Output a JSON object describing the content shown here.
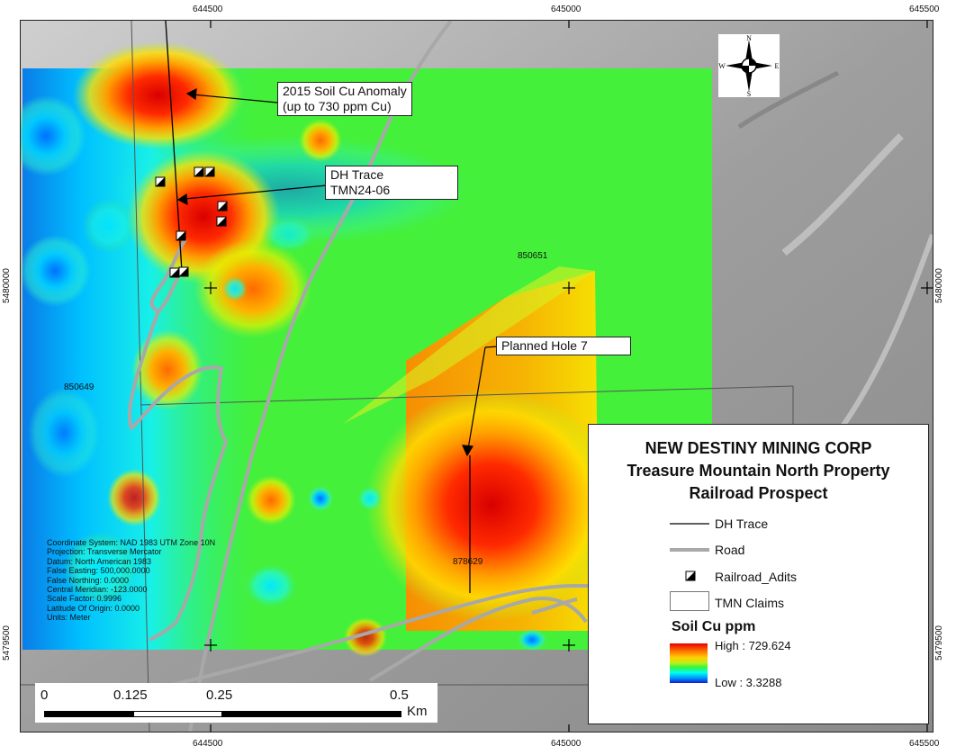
{
  "map": {
    "top_coords": [
      "644500",
      "645000",
      "645500"
    ],
    "bottom_coords": [
      "644500",
      "645000",
      "645500"
    ],
    "left_coords": [
      "5480000",
      "5479500"
    ],
    "right_coords": [
      "5480000",
      "5479500"
    ],
    "claim_labels": [
      "850651",
      "850649",
      "878629"
    ],
    "callouts": {
      "anomaly_line1": "2015 Soil Cu Anomaly",
      "anomaly_line2": "(up to 730 ppm Cu)",
      "dh_line1": "DH Trace",
      "dh_line2": "TMN24-06",
      "planned": "Planned Hole 7"
    },
    "north_arrow": {
      "n": "N",
      "s": "S",
      "e": "E",
      "w": "W",
      "icon": "north-arrow-icon"
    },
    "coordinate_info": [
      "Coordinate System: NAD 1983 UTM Zone 10N",
      "Projection: Transverse Mercator",
      "Datum: North American 1983",
      "False Easting: 500,000.0000",
      "False Northing: 0.0000",
      "Central Meridian: -123.0000",
      "Scale Factor: 0.9996",
      "Latitude Of Origin: 0.0000",
      "Units: Meter"
    ]
  },
  "legend": {
    "title1": "NEW DESTINY MINING CORP",
    "title2": "Treasure Mountain North Property",
    "title3": "Railroad Prospect",
    "items": [
      "DH Trace",
      "Road",
      "Railroad_Adits",
      "TMN Claims"
    ],
    "ramp_title": "Soil Cu ppm",
    "high_label": "High : 729.624",
    "low_label": "Low : 3.3288",
    "colors": {
      "high": "#e60000",
      "mid": "#38f53a",
      "low": "#1020c8",
      "road": "#a8a8a8"
    }
  },
  "scale": {
    "labels": [
      "0",
      "0.125",
      "0.25",
      "0.5"
    ],
    "unit": "Km"
  }
}
